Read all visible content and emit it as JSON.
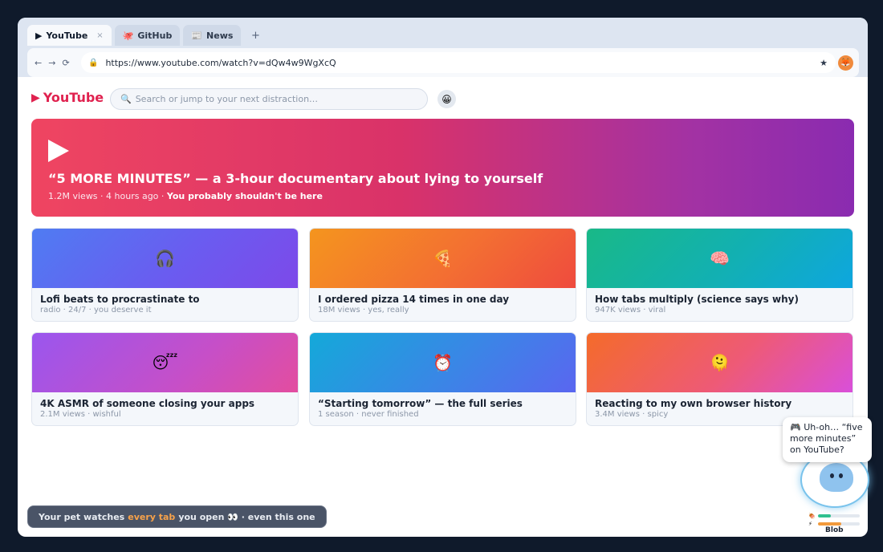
{
  "browser": {
    "tabs": [
      {
        "icon": "▶",
        "label": "YouTube",
        "close": "×"
      },
      {
        "icon": "🐙",
        "label": "GitHub"
      },
      {
        "icon": "📰",
        "label": "News"
      }
    ],
    "new_tab": "+",
    "nav": {
      "back": "←",
      "forward": "→",
      "reload": "⟳"
    },
    "url": "https://www.youtube.com/watch?v=dQw4w9WgXcQ",
    "lock_icon": "🔒",
    "star_icon": "★",
    "extension_icon": "🦊"
  },
  "youtube": {
    "logo_icon": "▶",
    "logo_text": "YouTube",
    "search_icon": "🔍",
    "search_placeholder": "Search or jump to your next distraction…",
    "avatar_icon": "😀",
    "hero": {
      "title": "“5 MORE MINUTES” — a 3-hour documentary about lying to yourself",
      "meta": "1.2M views · 4 hours ago · ",
      "meta_strong": "You probably shouldn't be here"
    },
    "videos": [
      {
        "icon": "🎧",
        "title": "Lofi beats to procrastinate to",
        "meta": "radio · 24/7 · you deserve it"
      },
      {
        "icon": "🍕",
        "title": "I ordered pizza 14 times in one day",
        "meta": "18M views · yes, really"
      },
      {
        "icon": "🧠",
        "title": "How tabs multiply (science says why)",
        "meta": "947K views · viral"
      },
      {
        "icon": "😴",
        "title": "4K ASMR of someone closing your apps",
        "meta": "2.1M views · wishful"
      },
      {
        "icon": "⏰",
        "title": "“Starting tomorrow” — the full series",
        "meta": "1 season · never finished"
      },
      {
        "icon": "🫠",
        "title": "Reacting to my own browser history",
        "meta": "3.4M views · spicy"
      }
    ]
  },
  "toast": {
    "before": "Your pet watches",
    "highlight": "every tab",
    "after": "you open 👀 · even this one"
  },
  "pet": {
    "bubble": "🎮 Uh-oh… “five more minutes” on YouTube?",
    "name": "Blob",
    "stats": [
      {
        "icon": "🍖",
        "level": 0.3,
        "color": "#2fc08f"
      },
      {
        "icon": "⚡",
        "level": 0.55,
        "color": "#f29a3c"
      }
    ]
  }
}
